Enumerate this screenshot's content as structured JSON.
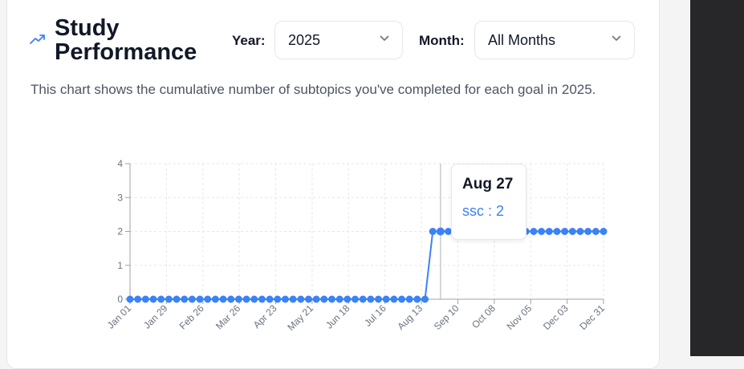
{
  "header": {
    "title_line1": "Study",
    "title_line2": "Performance",
    "icon": "trend-up-icon"
  },
  "filters": {
    "year_label": "Year:",
    "year_value": "2025",
    "month_label": "Month:",
    "month_value": "All Months"
  },
  "description": "This chart shows the cumulative number of subtopics you've completed for each goal in 2025.",
  "tooltip": {
    "date": "Aug 27",
    "series": "ssc",
    "value": "2",
    "separator": " : "
  },
  "colors": {
    "accent": "#3b82f6",
    "grid": "#e5e7eb",
    "axis": "#9ca3af"
  },
  "chart_data": {
    "type": "line",
    "title": "",
    "xlabel": "",
    "ylabel": "",
    "ylim": [
      0,
      4
    ],
    "yticks": [
      "0",
      "1",
      "2",
      "3",
      "4"
    ],
    "xticks": [
      "Jan 01",
      "Jan 29",
      "Feb 26",
      "Mar 26",
      "Apr 23",
      "May 21",
      "Jun 18",
      "Jul 16",
      "Aug 13",
      "Sep 10",
      "Oct 08",
      "Nov 05",
      "Dec 03",
      "Dec 31"
    ],
    "grid": true,
    "active_index": 40,
    "series": [
      {
        "name": "ssc",
        "values": [
          0,
          0,
          0,
          0,
          0,
          0,
          0,
          0,
          0,
          0,
          0,
          0,
          0,
          0,
          0,
          0,
          0,
          0,
          0,
          0,
          0,
          0,
          0,
          0,
          0,
          0,
          0,
          0,
          0,
          0,
          0,
          0,
          0,
          0,
          0,
          0,
          0,
          0,
          0,
          2,
          2,
          2,
          2,
          2,
          2,
          2,
          2,
          2,
          2,
          2,
          2,
          2,
          2,
          2,
          2,
          2,
          2,
          2,
          2,
          2,
          2,
          2
        ]
      }
    ]
  }
}
